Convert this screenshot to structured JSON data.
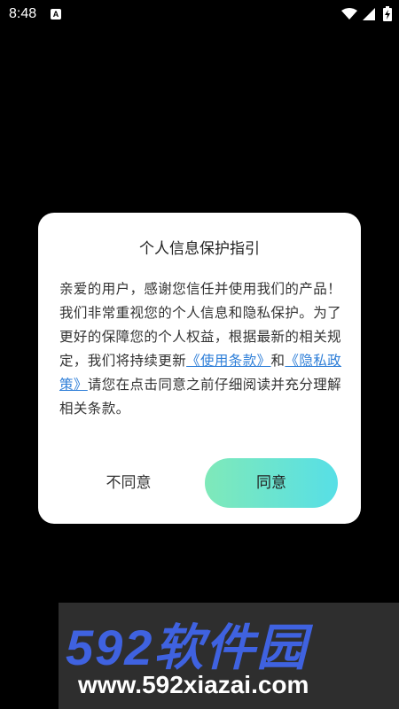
{
  "status_bar": {
    "time": "8:48",
    "notification_letter": "A"
  },
  "dialog": {
    "title": "个人信息保护指引",
    "body_before": "亲爱的用户，感谢您信任并使用我们的产品！我们非常重视您的个人信息和隐私保护。为了更好的保障您的个人权益，根据最新的相关规定，我们将持续更新",
    "link_terms": "《使用条款》",
    "conjunction": "和",
    "link_privacy": "《隐私政策》",
    "body_after": "请您在点击同意之前仔细阅读并充分理解相关条款。",
    "disagree_label": "不同意",
    "agree_label": "同意",
    "agree_gradient": [
      "#7fe9b9",
      "#57dfe6"
    ],
    "link_color": "#2f7fd8"
  },
  "watermark": {
    "brand": "592软件园",
    "url": "www.592xiazai.com"
  }
}
